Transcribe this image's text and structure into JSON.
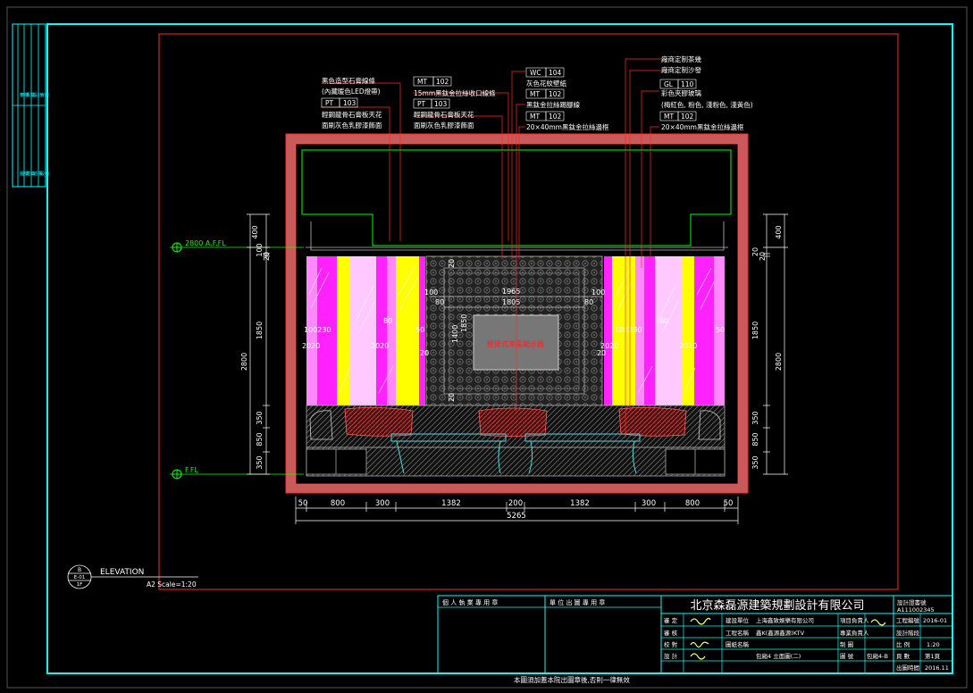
{
  "colors": {
    "background": "#000000",
    "frame": "#00ffff",
    "outline": "#ff2a2a",
    "wall": "#c85a5a",
    "pink": "#ff88ff",
    "magenta": "#ff22ff",
    "yellow": "#ffff00",
    "lightpink": "#ffc8ff",
    "dim": "#ffffff",
    "green": "#00ff00",
    "screen_text": "#ff2020"
  },
  "callouts": {
    "left": {
      "line1": "黑色造型石膏線條",
      "line2": "(內藏暖色LED燈帶)",
      "tag": "PT",
      "code": "103",
      "line3": "輕鋼龍骨石膏板天花",
      "line4": "面刷灰色乳膠漆飾面"
    },
    "mid_left": {
      "tag1": "MT",
      "code1": "102",
      "line1": "15mm黑鈦金拉絲收口線條",
      "tag2": "PT",
      "code2": "103",
      "line2": "輕鋼龍骨石膏板天花",
      "line3": "面刷灰色乳膠漆飾面"
    },
    "mid_right": {
      "tag1": "WC",
      "code1": "104",
      "line1": "灰色花紋壁紙",
      "tag2": "MT",
      "code2": "102",
      "line2": "黑鈦金拉絲踢腳線",
      "tag3": "MT",
      "code3": "102",
      "line3": "20×40mm黑鈦金拉絲邊框"
    },
    "right": {
      "line1": "廠商定制茶幾",
      "line2": "廠商定制沙發",
      "tag1": "GL",
      "code1": "110",
      "line3": "彩色夾膠玻璃",
      "line4": "(梅紅色, 粉色, 淺粉色, 淺黃色)",
      "tag2": "MT",
      "code2": "102",
      "line5": "20×40mm黑鈦金拉絲邊框"
    }
  },
  "levels": {
    "ceiling": "2800 A.F.FL",
    "floor": "F.FL"
  },
  "left_dims": [
    "400",
    "100",
    "20",
    "1850",
    "2800",
    "350",
    "850",
    "350"
  ],
  "right_dims": [
    "400",
    "20",
    "20",
    "1850",
    "2800",
    "350",
    "850",
    "350"
  ],
  "inner_dims": {
    "w1965": "1965",
    "w1805": "1805",
    "d100": "100",
    "d80": "80",
    "h1850": "1850",
    "h1400": "1400",
    "d20": "20",
    "left_row": "100230",
    "left_row2": "2020",
    "right_row": "100230",
    "right_row2": "2020",
    "d50": "50"
  },
  "screen_text": "壁掛式液晶顯示器",
  "bottom_dims": [
    "50",
    "800",
    "300",
    "1382",
    "200",
    "1382",
    "300",
    "800",
    "50"
  ],
  "total_dim": "5265",
  "elevation_tag": {
    "top": "B",
    "mid": "E-01",
    "bot": "1F",
    "title": "ELEVATION",
    "scale": "A2 Scale=1:20"
  },
  "left_strip": [
    "審核",
    "專業",
    "設計",
    "會簽",
    "圖號",
    "建築",
    "結構",
    "設備"
  ],
  "stamp_labels": {
    "personal": "個 人 執 業 專 用 章",
    "company": "單 位 出 圖 專 用 章"
  },
  "title_block": {
    "company": "北京森磊源建築規劃設計有限公司",
    "cert_label": "設計證書號",
    "cert_no": "A111002345",
    "rows": [
      {
        "a": "審 定",
        "b": "建設單位",
        "c": "上海鑫致娛樂有限公司",
        "d": "項目負責人",
        "e": "",
        "f": "工程編號",
        "g": "2016-01"
      },
      {
        "a": "審 核",
        "b": "工程名稱",
        "c": "鑫K(鑫源鑫源)KTV",
        "d": "專業負責人",
        "e": "",
        "f": "設計階段",
        "g": ""
      },
      {
        "a": "校 對",
        "b": "圖紙名稱",
        "c": "",
        "d": "制 圖",
        "e": "",
        "f": "比 例",
        "g": "1:20"
      },
      {
        "a": "設 計",
        "b": "",
        "c": "包廂4 立面圖(二)",
        "d": "圖 號",
        "e": "包廂4-B",
        "f": "頁 數",
        "g": "第1頁"
      },
      {
        "a": "",
        "b": "",
        "c": "",
        "d": "",
        "e": "",
        "f": "出圖時間",
        "g": "2016.11"
      }
    ],
    "footer": "本圖須加蓋本院出圖章後,否則一律無效"
  }
}
